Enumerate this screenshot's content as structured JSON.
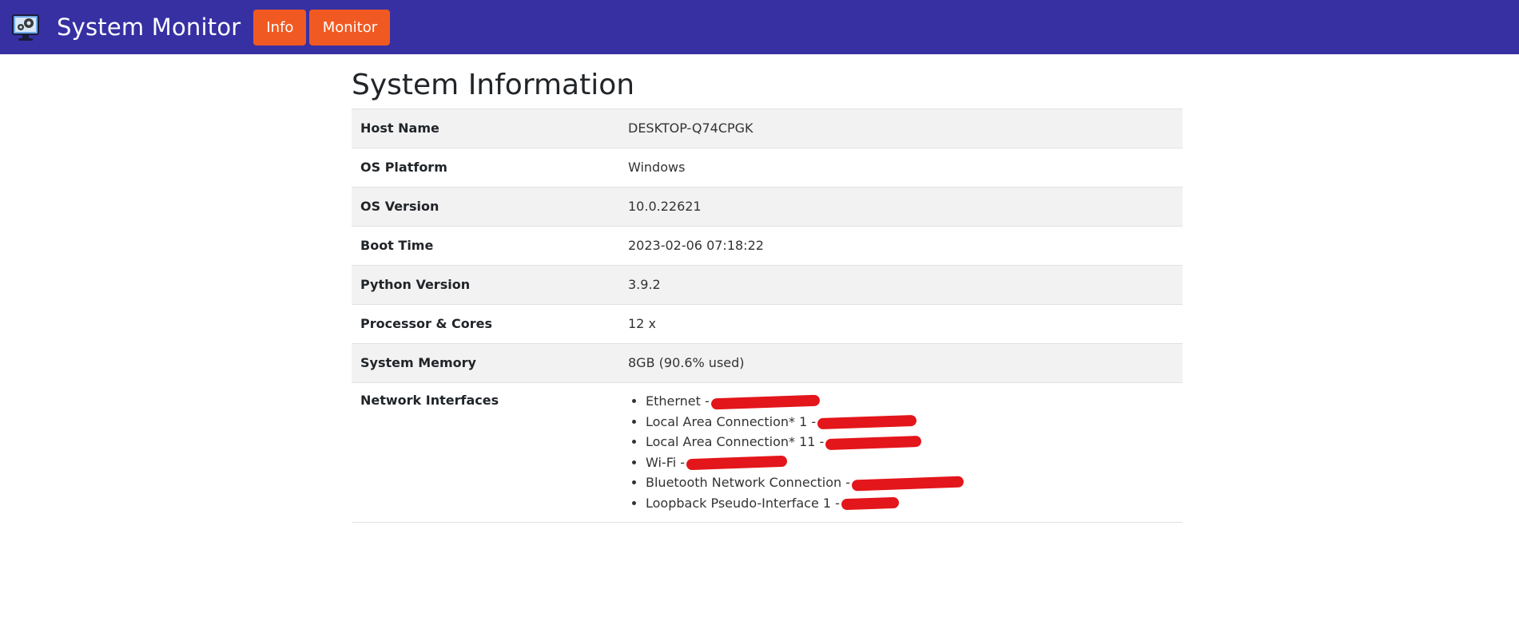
{
  "navbar": {
    "brand": "System Monitor",
    "buttons": {
      "info": "Info",
      "monitor": "Monitor"
    },
    "colors": {
      "background": "#3730a3",
      "button": "#f05a22"
    }
  },
  "page": {
    "title": "System Information"
  },
  "info": {
    "host_name": {
      "label": "Host Name",
      "value": "DESKTOP-Q74CPGK"
    },
    "os_platform": {
      "label": "OS Platform",
      "value": "Windows"
    },
    "os_version": {
      "label": "OS Version",
      "value": "10.0.22621"
    },
    "boot_time": {
      "label": "Boot Time",
      "value": "2023-02-06 07:18:22"
    },
    "python_version": {
      "label": "Python Version",
      "value": "3.9.2"
    },
    "processor": {
      "label": "Processor & Cores",
      "value": "12 x"
    },
    "memory": {
      "label": "System Memory",
      "value": "8GB (90.6% used)"
    },
    "network": {
      "label": "Network Interfaces",
      "items": [
        "Ethernet -",
        "Local Area Connection* 1 -",
        "Local Area Connection* 11 -",
        "Wi-Fi -",
        "Bluetooth Network Connection -",
        "Loopback Pseudo-Interface 1 -"
      ]
    }
  }
}
